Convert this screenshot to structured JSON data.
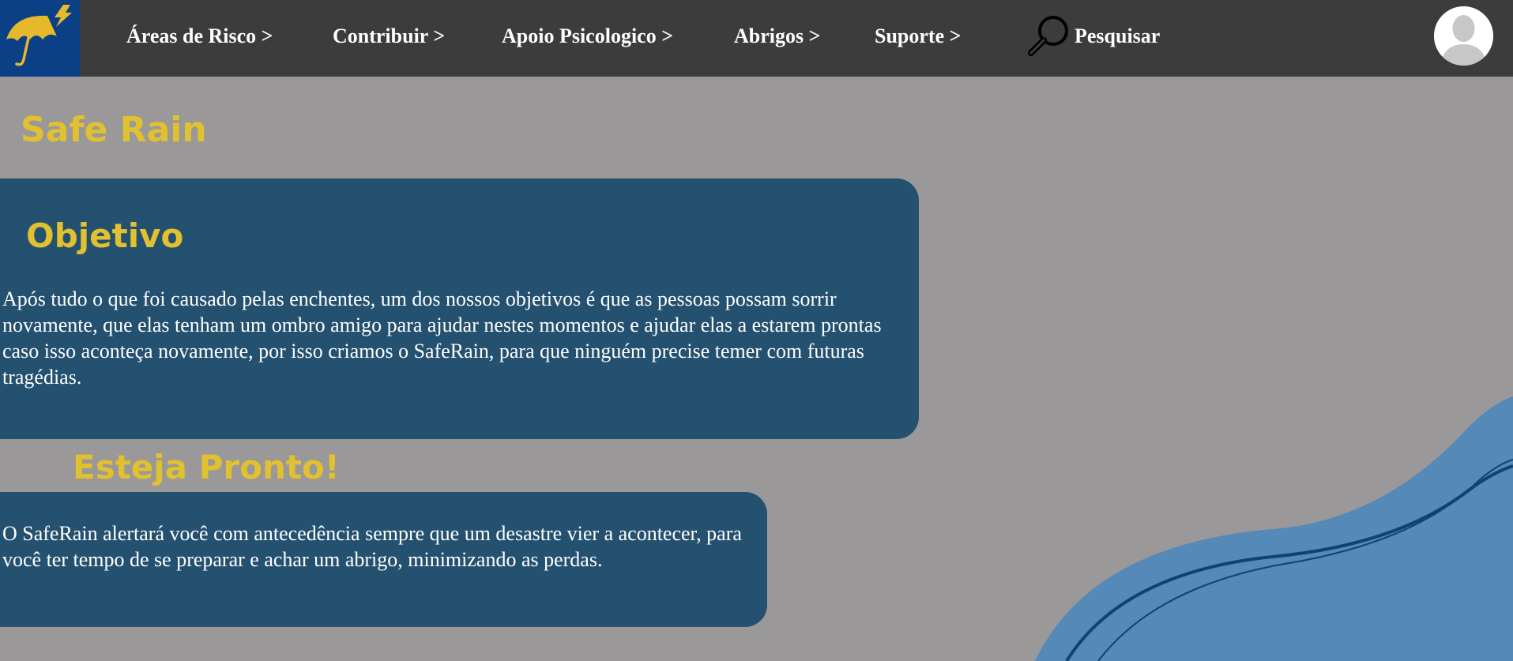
{
  "header": {
    "logo_icon": "umbrella-lightning-icon",
    "nav_items": [
      "Áreas de Risco >",
      "Contribuir >",
      "Apoio Psicologico >",
      "Abrigos >",
      "Suporte >"
    ],
    "search_icon": "magnifier-icon",
    "search_label": "Pesquisar",
    "avatar_icon": "user-avatar-icon"
  },
  "main": {
    "site_title": "Safe Rain",
    "objetivo": {
      "heading": "Objetivo",
      "text": "Após tudo o que foi causado pelas enchentes, um dos nossos objetivos é que as pessoas possam sorrir novamente, que elas tenham um ombro amigo para ajudar nestes momentos e ajudar elas a estarem prontas caso isso aconteça novamente, por isso criamos o SafeRain, para que ninguém precise temer com futuras tragédias."
    },
    "pronto": {
      "heading": "Esteja Pronto!",
      "text": "O SafeRain alertará você com antecedência sempre que um desastre vier a acontecer, para você ter tempo de se preparar e achar um abrigo, minimizando as perdas."
    }
  },
  "colors": {
    "navbar": "#3c3c3c",
    "logo_bg": "#0b3f86",
    "page_bg": "#9a9899",
    "card_bg": "#255170",
    "accent_yellow": "#e1c12f",
    "wave_light": "#7ab5d9",
    "wave_mid": "#5489b8",
    "wave_dark": "#12426e"
  }
}
